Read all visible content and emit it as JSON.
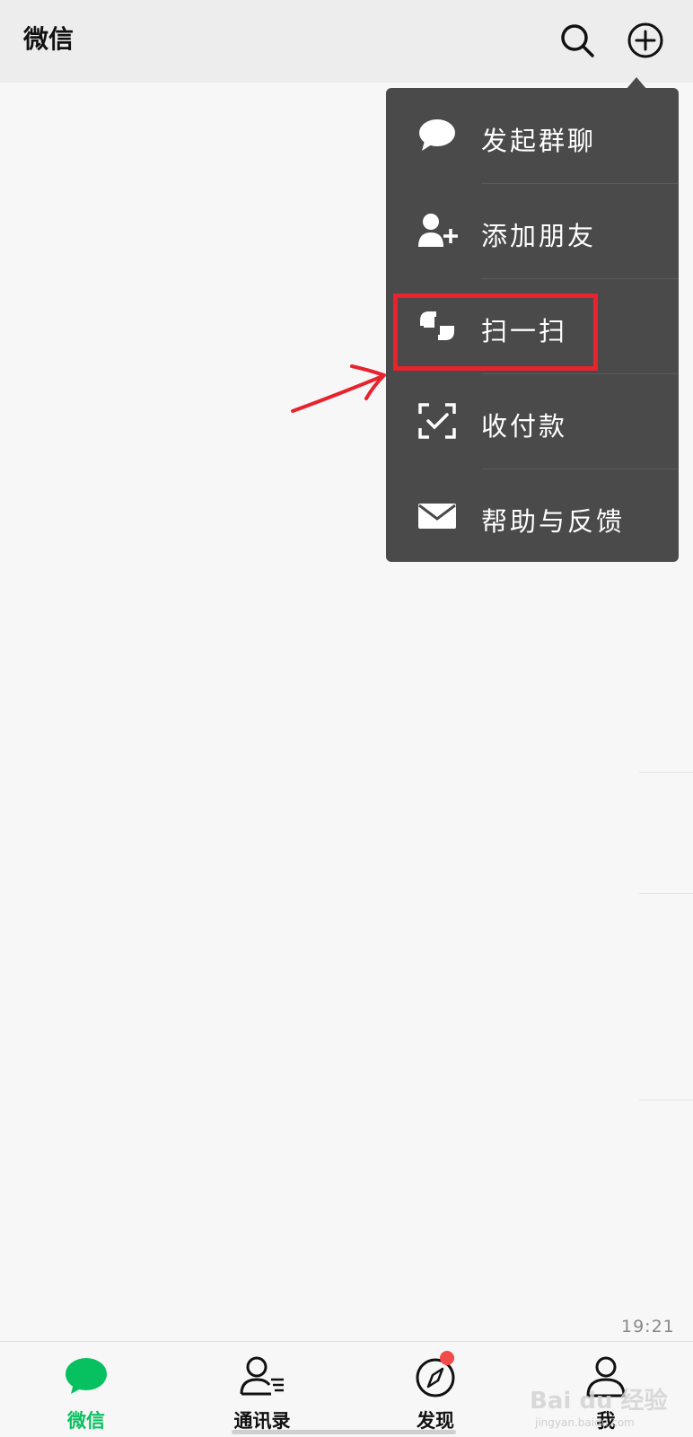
{
  "header": {
    "title": "微信",
    "search_icon": "search-icon",
    "add_icon": "plus-circle-icon"
  },
  "menu": {
    "items": [
      {
        "label": "发起群聊",
        "icon": "chat-bubble-icon"
      },
      {
        "label": "添加朋友",
        "icon": "add-friend-icon"
      },
      {
        "label": "扫一扫",
        "icon": "scan-icon"
      },
      {
        "label": "收付款",
        "icon": "pay-check-icon"
      },
      {
        "label": "帮助与反馈",
        "icon": "mail-icon"
      }
    ]
  },
  "annotation": {
    "highlight_color": "#e8232e"
  },
  "time": "19:21",
  "tabs": [
    {
      "label": "微信",
      "icon": "chat-icon",
      "active": true
    },
    {
      "label": "通讯录",
      "icon": "contacts-icon",
      "active": false
    },
    {
      "label": "发现",
      "icon": "compass-icon",
      "active": false
    },
    {
      "label": "我",
      "icon": "person-icon",
      "active": false
    }
  ],
  "watermark": {
    "brand": "Bai du 经验",
    "url": "jingyan.baidu.com"
  },
  "colors": {
    "accent": "#07c160",
    "menu_bg": "#4a4a4a",
    "badge": "#f34a4a"
  }
}
